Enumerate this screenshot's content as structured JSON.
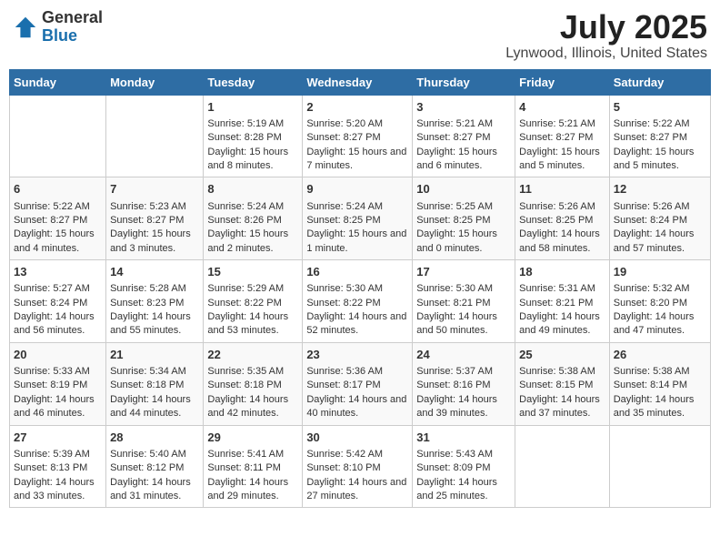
{
  "header": {
    "logo": {
      "general": "General",
      "blue": "Blue"
    },
    "title": "July 2025",
    "subtitle": "Lynwood, Illinois, United States"
  },
  "weekdays": [
    "Sunday",
    "Monday",
    "Tuesday",
    "Wednesday",
    "Thursday",
    "Friday",
    "Saturday"
  ],
  "weeks": [
    [
      {
        "day": "",
        "content": ""
      },
      {
        "day": "",
        "content": ""
      },
      {
        "day": "1",
        "content": "Sunrise: 5:19 AM\nSunset: 8:28 PM\nDaylight: 15 hours and 8 minutes."
      },
      {
        "day": "2",
        "content": "Sunrise: 5:20 AM\nSunset: 8:27 PM\nDaylight: 15 hours and 7 minutes."
      },
      {
        "day": "3",
        "content": "Sunrise: 5:21 AM\nSunset: 8:27 PM\nDaylight: 15 hours and 6 minutes."
      },
      {
        "day": "4",
        "content": "Sunrise: 5:21 AM\nSunset: 8:27 PM\nDaylight: 15 hours and 5 minutes."
      },
      {
        "day": "5",
        "content": "Sunrise: 5:22 AM\nSunset: 8:27 PM\nDaylight: 15 hours and 5 minutes."
      }
    ],
    [
      {
        "day": "6",
        "content": "Sunrise: 5:22 AM\nSunset: 8:27 PM\nDaylight: 15 hours and 4 minutes."
      },
      {
        "day": "7",
        "content": "Sunrise: 5:23 AM\nSunset: 8:27 PM\nDaylight: 15 hours and 3 minutes."
      },
      {
        "day": "8",
        "content": "Sunrise: 5:24 AM\nSunset: 8:26 PM\nDaylight: 15 hours and 2 minutes."
      },
      {
        "day": "9",
        "content": "Sunrise: 5:24 AM\nSunset: 8:25 PM\nDaylight: 15 hours and 1 minute."
      },
      {
        "day": "10",
        "content": "Sunrise: 5:25 AM\nSunset: 8:25 PM\nDaylight: 15 hours and 0 minutes."
      },
      {
        "day": "11",
        "content": "Sunrise: 5:26 AM\nSunset: 8:25 PM\nDaylight: 14 hours and 58 minutes."
      },
      {
        "day": "12",
        "content": "Sunrise: 5:26 AM\nSunset: 8:24 PM\nDaylight: 14 hours and 57 minutes."
      }
    ],
    [
      {
        "day": "13",
        "content": "Sunrise: 5:27 AM\nSunset: 8:24 PM\nDaylight: 14 hours and 56 minutes."
      },
      {
        "day": "14",
        "content": "Sunrise: 5:28 AM\nSunset: 8:23 PM\nDaylight: 14 hours and 55 minutes."
      },
      {
        "day": "15",
        "content": "Sunrise: 5:29 AM\nSunset: 8:22 PM\nDaylight: 14 hours and 53 minutes."
      },
      {
        "day": "16",
        "content": "Sunrise: 5:30 AM\nSunset: 8:22 PM\nDaylight: 14 hours and 52 minutes."
      },
      {
        "day": "17",
        "content": "Sunrise: 5:30 AM\nSunset: 8:21 PM\nDaylight: 14 hours and 50 minutes."
      },
      {
        "day": "18",
        "content": "Sunrise: 5:31 AM\nSunset: 8:21 PM\nDaylight: 14 hours and 49 minutes."
      },
      {
        "day": "19",
        "content": "Sunrise: 5:32 AM\nSunset: 8:20 PM\nDaylight: 14 hours and 47 minutes."
      }
    ],
    [
      {
        "day": "20",
        "content": "Sunrise: 5:33 AM\nSunset: 8:19 PM\nDaylight: 14 hours and 46 minutes."
      },
      {
        "day": "21",
        "content": "Sunrise: 5:34 AM\nSunset: 8:18 PM\nDaylight: 14 hours and 44 minutes."
      },
      {
        "day": "22",
        "content": "Sunrise: 5:35 AM\nSunset: 8:18 PM\nDaylight: 14 hours and 42 minutes."
      },
      {
        "day": "23",
        "content": "Sunrise: 5:36 AM\nSunset: 8:17 PM\nDaylight: 14 hours and 40 minutes."
      },
      {
        "day": "24",
        "content": "Sunrise: 5:37 AM\nSunset: 8:16 PM\nDaylight: 14 hours and 39 minutes."
      },
      {
        "day": "25",
        "content": "Sunrise: 5:38 AM\nSunset: 8:15 PM\nDaylight: 14 hours and 37 minutes."
      },
      {
        "day": "26",
        "content": "Sunrise: 5:38 AM\nSunset: 8:14 PM\nDaylight: 14 hours and 35 minutes."
      }
    ],
    [
      {
        "day": "27",
        "content": "Sunrise: 5:39 AM\nSunset: 8:13 PM\nDaylight: 14 hours and 33 minutes."
      },
      {
        "day": "28",
        "content": "Sunrise: 5:40 AM\nSunset: 8:12 PM\nDaylight: 14 hours and 31 minutes."
      },
      {
        "day": "29",
        "content": "Sunrise: 5:41 AM\nSunset: 8:11 PM\nDaylight: 14 hours and 29 minutes."
      },
      {
        "day": "30",
        "content": "Sunrise: 5:42 AM\nSunset: 8:10 PM\nDaylight: 14 hours and 27 minutes."
      },
      {
        "day": "31",
        "content": "Sunrise: 5:43 AM\nSunset: 8:09 PM\nDaylight: 14 hours and 25 minutes."
      },
      {
        "day": "",
        "content": ""
      },
      {
        "day": "",
        "content": ""
      }
    ]
  ]
}
